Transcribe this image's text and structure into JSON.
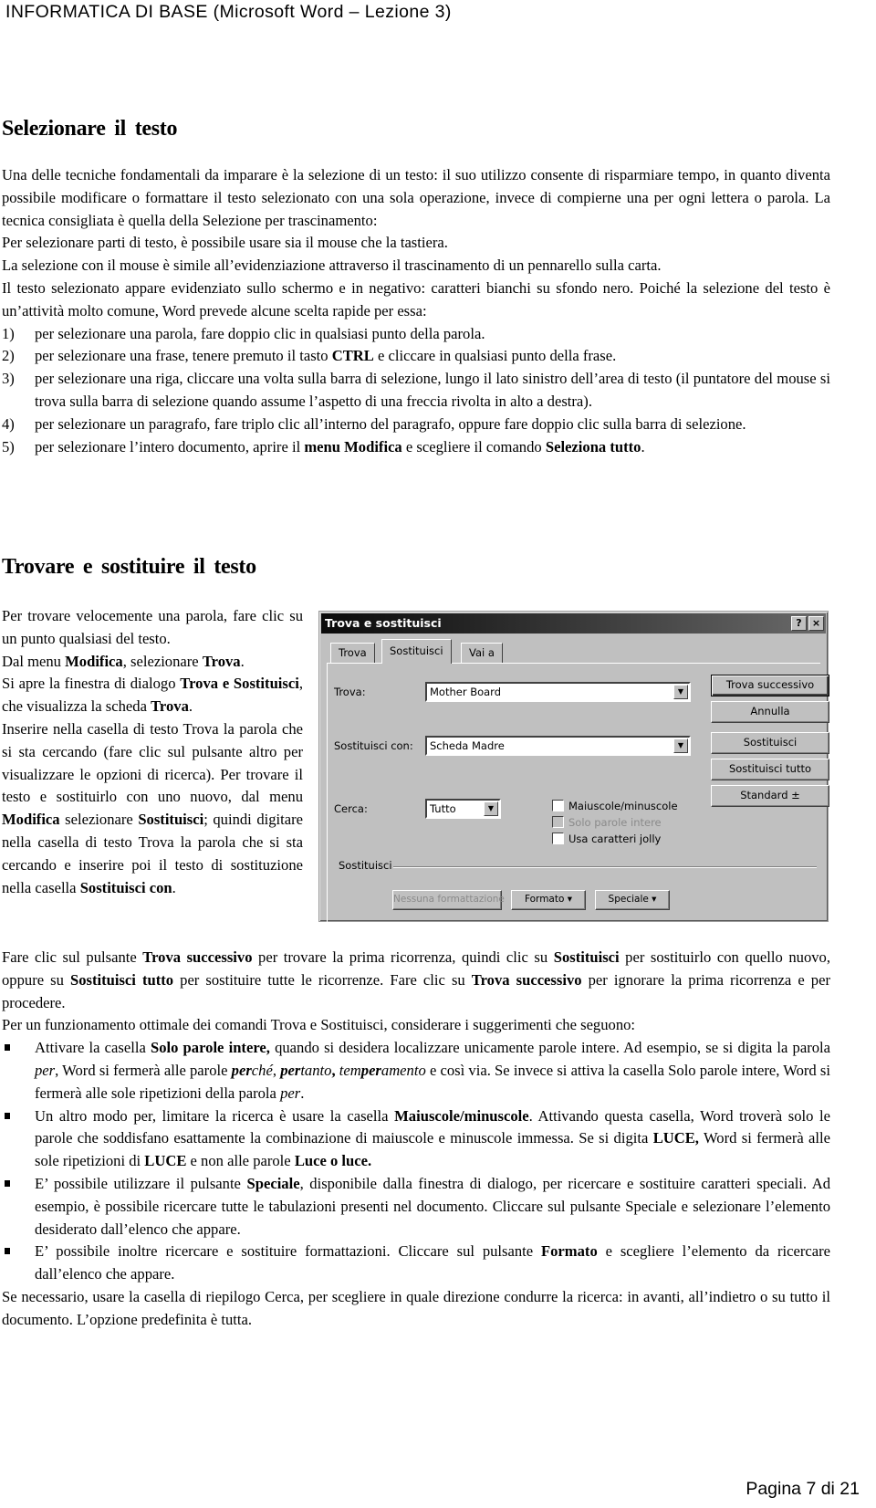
{
  "header": {
    "title": "INFORMATICA DI BASE (Microsoft Word – Lezione 3)"
  },
  "section1": {
    "title": "Selezionare il testo",
    "paragraphs": [
      "Una delle tecniche fondamentali da imparare è la selezione di un testo: il suo utilizzo consente di risparmiare tempo, in quanto diventa possibile modificare o formattare il testo selezionato con una sola operazione, invece di compierne una per ogni lettera o parola. La tecnica consigliata è quella della Selezione per trascinamento:",
      "Per selezionare parti di testo, è possibile usare sia il mouse che la tastiera.",
      "La selezione con il mouse è simile all’evidenziazione attraverso il trascinamento di un pennarello sulla carta.",
      "Il testo selezionato appare evidenziato sullo schermo e in negativo: caratteri bianchi su sfondo nero. Poiché la selezione del testo è un’attività molto comune, Word prevede alcune scelta rapide per essa:"
    ],
    "list": [
      {
        "num": "1)",
        "parts": [
          {
            "t": "per selezionare una parola, fare doppio clic in qualsiasi punto della parola."
          }
        ]
      },
      {
        "num": "2)",
        "parts": [
          {
            "t": "per selezionare una frase, tenere premuto il tasto "
          },
          {
            "t": "CTRL",
            "b": true
          },
          {
            "t": " e cliccare in qualsiasi punto della frase."
          }
        ]
      },
      {
        "num": "3)",
        "parts": [
          {
            "t": "per selezionare una riga, cliccare una volta sulla barra di selezione, lungo il lato sinistro dell’area di testo (il puntatore del mouse si trova sulla barra di selezione quando assume l’aspetto di una freccia rivolta in alto a destra)."
          }
        ]
      },
      {
        "num": "4)",
        "parts": [
          {
            "t": "per selezionare un paragrafo, fare triplo clic all’interno del paragrafo, oppure fare doppio clic sulla barra di selezione."
          }
        ]
      },
      {
        "num": "5)",
        "parts": [
          {
            "t": "per selezionare l’intero documento, aprire il "
          },
          {
            "t": "menu Modifica",
            "b": true
          },
          {
            "t": " e scegliere il comando "
          },
          {
            "t": "Seleziona tutto",
            "b": true
          },
          {
            "t": "."
          }
        ]
      }
    ]
  },
  "section2": {
    "title": "Trovare e sostituire il testo",
    "wrap_paragraphs": [
      [
        {
          "t": "Per trovare velocemente una parola, fare clic su un punto qualsiasi del testo."
        }
      ],
      [
        {
          "t": "Dal menu "
        },
        {
          "t": "Modifica",
          "b": true
        },
        {
          "t": ", selezionare "
        },
        {
          "t": "Trova",
          "b": true
        },
        {
          "t": "."
        }
      ],
      [
        {
          "t": "Si apre la finestra di dialogo "
        },
        {
          "t": "Trova e Sostituisci",
          "b": true
        },
        {
          "t": ", che visualizza la scheda "
        },
        {
          "t": "Trova",
          "b": true
        },
        {
          "t": "."
        }
      ],
      [
        {
          "t": "Inserire nella casella di testo Trova la parola che si sta cercando (fare clic sul pulsante altro per visualizzare le opzioni di ricerca). Per trovare il testo e sostituirlo con uno nuovo, dal menu "
        },
        {
          "t": "Modifica",
          "b": true
        },
        {
          "t": " selezionare "
        },
        {
          "t": "Sostituisci",
          "b": true
        },
        {
          "t": "; quindi digitare nella casella di testo Trova la parola che si sta cercando e inserire poi il testo di sostituzione nella casella "
        },
        {
          "t": "Sostituisci con",
          "b": true
        },
        {
          "t": "."
        }
      ]
    ],
    "after_paragraphs": [
      [
        {
          "t": "Fare clic sul pulsante "
        },
        {
          "t": "Trova successivo",
          "b": true
        },
        {
          "t": " per trovare la prima ricorrenza, quindi clic su "
        },
        {
          "t": "Sostituisci",
          "b": true
        },
        {
          "t": " per sostituirlo con quello nuovo, oppure su "
        },
        {
          "t": "Sostituisci tutto",
          "b": true
        },
        {
          "t": " per sostituire tutte le ricorrenze. Fare clic su "
        },
        {
          "t": "Trova successivo",
          "b": true
        },
        {
          "t": " per ignorare la prima ricorrenza e per procedere."
        }
      ],
      [
        {
          "t": "Per un funzionamento ottimale dei comandi Trova e Sostituisci, considerare i suggerimenti che seguono:"
        }
      ]
    ],
    "bullets": [
      [
        {
          "t": "Attivare la casella "
        },
        {
          "t": "Solo parole intere,",
          "b": true
        },
        {
          "t": " quando si desidera localizzare unicamente parole intere. Ad esempio, se si digita la parola "
        },
        {
          "t": "per",
          "i": true
        },
        {
          "t": ", Word si fermerà alle parole "
        },
        {
          "t": "per",
          "b": true,
          "i": true
        },
        {
          "t": "ché",
          "i": true
        },
        {
          "t": ", "
        },
        {
          "t": "per",
          "b": true,
          "i": true
        },
        {
          "t": "tanto",
          "i": true
        },
        {
          "t": ",",
          "b": true
        },
        {
          "t": " "
        },
        {
          "t": "tem",
          "i": true
        },
        {
          "t": "per",
          "b": true,
          "i": true
        },
        {
          "t": "amento",
          "i": true
        },
        {
          "t": " e così via. Se invece si attiva la casella Solo parole intere, Word si fermerà alle sole ripetizioni della parola "
        },
        {
          "t": "per",
          "i": true
        },
        {
          "t": "."
        }
      ],
      [
        {
          "t": "Un altro modo per, limitare la ricerca è usare la casella "
        },
        {
          "t": "Maiuscole/minuscole",
          "b": true
        },
        {
          "t": ". Attivando questa casella, Word troverà solo le parole che soddisfano esattamente la combinazione di maiuscole e minuscole immessa. Se si digita "
        },
        {
          "t": "LUCE,",
          "b": true
        },
        {
          "t": " Word si fermerà alle sole ripetizioni di "
        },
        {
          "t": "LUCE",
          "b": true
        },
        {
          "t": " e non alle parole "
        },
        {
          "t": "Luce o luce.",
          "b": true
        }
      ],
      [
        {
          "t": "E’ possibile utilizzare il pulsante "
        },
        {
          "t": "Speciale",
          "b": true
        },
        {
          "t": ", disponibile dalla finestra di dialogo, per ricercare e sostituire caratteri speciali. Ad esempio, è possibile ricercare tutte le tabulazioni presenti nel documento. Cliccare sul pulsante Speciale e selezionare l’elemento desiderato dall’elenco che appare."
        }
      ],
      [
        {
          "t": "E’ possibile inoltre ricercare e sostituire formattazioni. Cliccare sul pulsante "
        },
        {
          "t": "Formato",
          "b": true
        },
        {
          "t": " e scegliere l’elemento da ricercare dall’elenco che appare."
        }
      ]
    ],
    "closing": [
      [
        {
          "t": "Se necessario, usare la casella di riepilogo Cerca, per scegliere in quale direzione condurre la ricerca: in avanti, all’indietro o su tutto il documento. L’opzione predefinita è tutta."
        }
      ]
    ]
  },
  "dialog": {
    "title": "Trova e sostituisci",
    "help_glyph": "?",
    "close_glyph": "×",
    "tabs": [
      {
        "label": "Trova",
        "active": false
      },
      {
        "label": "Sostituisci",
        "active": true
      },
      {
        "label": "Vai a",
        "active": false
      }
    ],
    "find_label": "Trova:",
    "find_value": "Mother Board",
    "replace_label": "Sostituisci con:",
    "replace_value": "Scheda Madre",
    "search_label": "Cerca:",
    "search_value": "Tutto",
    "dropdown_glyph": "▼",
    "checkboxes": [
      {
        "label": "Maiuscole/minuscole",
        "checked": false,
        "disabled": false
      },
      {
        "label": "Solo parole intere",
        "checked": false,
        "disabled": true
      },
      {
        "label": "Usa caratteri jolly",
        "checked": false,
        "disabled": false
      }
    ],
    "buttons": {
      "find_next": "Trova successivo",
      "cancel": "Annulla",
      "replace": "Sostituisci",
      "replace_all": "Sostituisci tutto",
      "standard": "Standard ±"
    },
    "group_label": "Sostituisci",
    "bottom_buttons": {
      "no_format": "Nessuna formattazione",
      "format": "Formato ▾",
      "special": "Speciale ▾"
    }
  },
  "footer": {
    "page": "Pagina 7 di 21"
  }
}
